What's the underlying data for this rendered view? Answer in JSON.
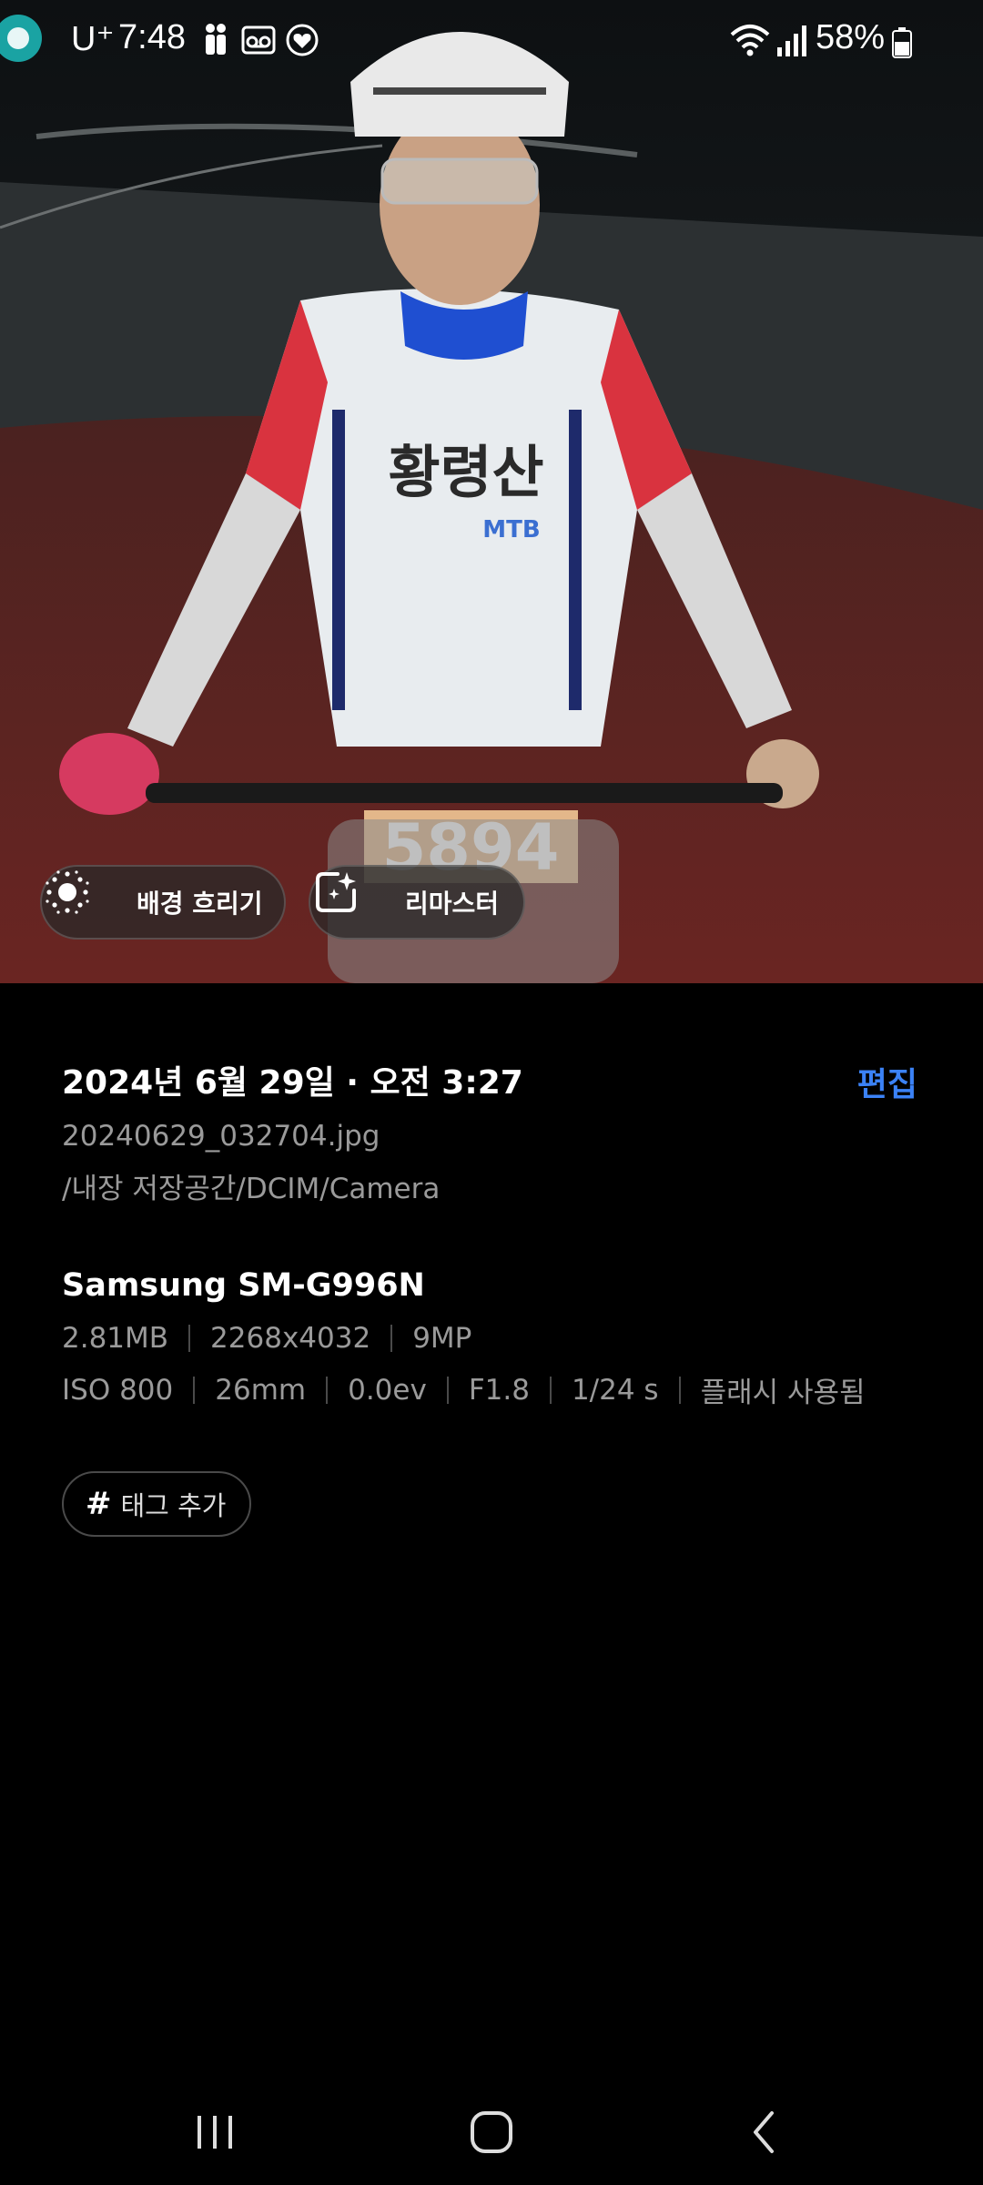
{
  "status_bar": {
    "carrier": "U⁺",
    "time": "7:48",
    "battery_percent": "58%",
    "icons": [
      "people-icon",
      "voicemail-icon",
      "heart-icon",
      "wifi-icon",
      "signal-icon",
      "battery-icon"
    ]
  },
  "photo": {
    "jersey_text": "황령산",
    "jersey_sub": "MTB",
    "bib_number": "5894",
    "actions": [
      {
        "label": "배경 흐리기",
        "icon": "background-blur-icon"
      },
      {
        "label": "리마스터",
        "icon": "remaster-icon"
      }
    ]
  },
  "details": {
    "date": "2024년 6월 29일 · 오전 3:27",
    "edit_label": "편집",
    "filename": "20240629_032704.jpg",
    "path": "/내장 저장공간/DCIM/Camera",
    "model": "Samsung SM-G996N",
    "size_row": [
      "2.81MB",
      "2268x4032",
      "9MP"
    ],
    "exif_row": [
      "ISO 800",
      "26mm",
      "0.0ev",
      "F1.8",
      "1/24 s",
      "플래시 사용됨"
    ],
    "tag_button_label": "태그 추가"
  },
  "nav": {
    "buttons": [
      "recent-apps",
      "home",
      "back"
    ]
  },
  "colors": {
    "accent": "#3b82f6",
    "background": "#000000",
    "secondary_text": "#9a9a9a"
  }
}
